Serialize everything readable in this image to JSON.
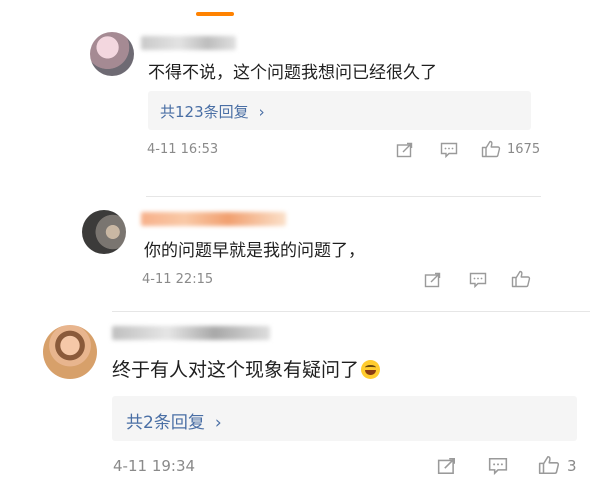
{
  "comments": [
    {
      "text": "不得不说，这个问题我想问已经很久了",
      "replies_label": "共123条回复",
      "date": "4-11",
      "time": "16:53",
      "likes": "1675"
    },
    {
      "text": "你的问题早就是我的问题了，",
      "date": "4-11",
      "time": "22:15",
      "likes": ""
    },
    {
      "text": "终于有人对这个现象有疑问了",
      "emoji": "laughing-emoji",
      "replies_label": "共2条回复",
      "date": "4-11",
      "time": "19:34",
      "likes": "3"
    }
  ],
  "chevron": "›",
  "colors": {
    "accent": "#ff8200",
    "link": "#4a6fa5",
    "meta": "#8a8a8a"
  },
  "icons": [
    "share-icon",
    "comment-icon",
    "like-icon"
  ]
}
